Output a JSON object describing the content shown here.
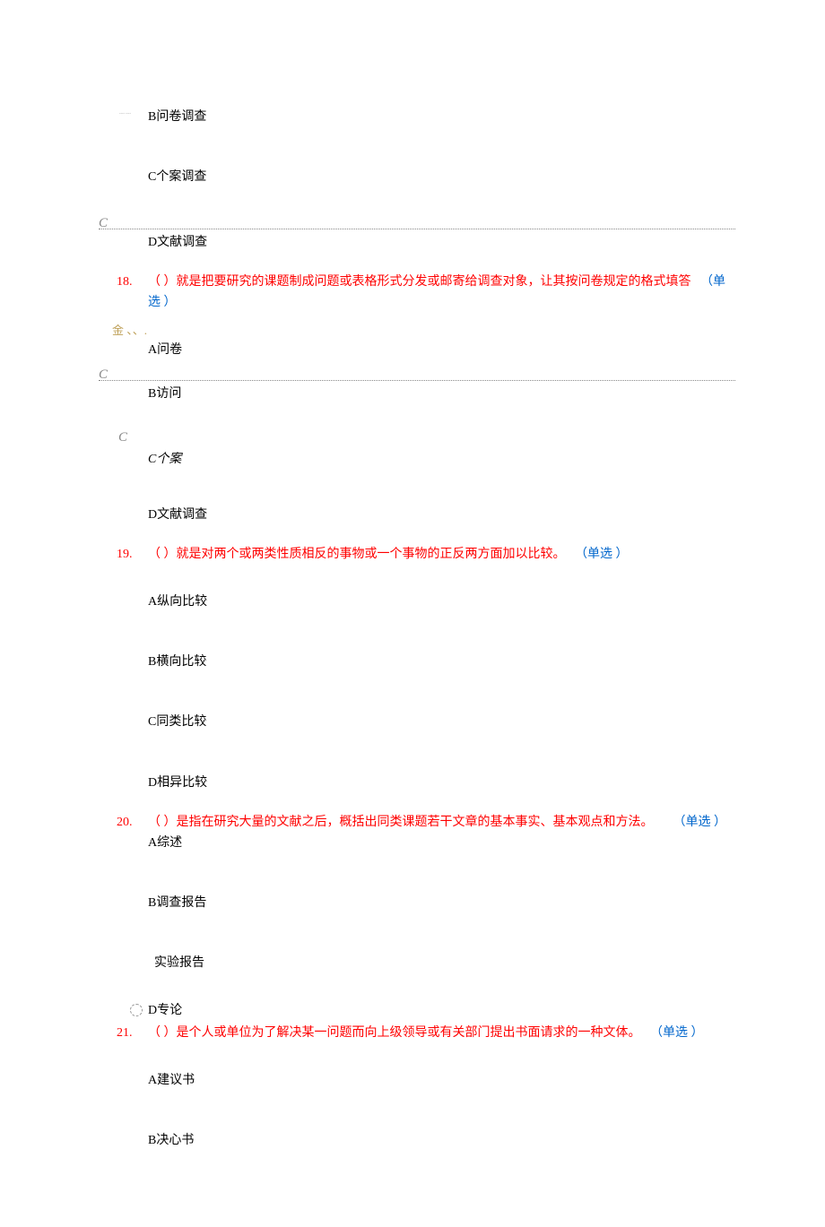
{
  "prev_question": {
    "options": {
      "B": "B问卷调查",
      "C": "C个案调查",
      "D": "D文献调查"
    },
    "margin_C": "C"
  },
  "q18": {
    "num": "18.",
    "stem": "（ ）就是把要研究的课题制成问题或表格形式分发或邮寄给调查对象，让其按问卷规定的格式填答",
    "tag": "（单选 ）",
    "margin_gold": "金 、、.",
    "options": {
      "A": "A问卷",
      "B": "B访问",
      "C": "C个案",
      "D": "D文献调查"
    },
    "margin_C1": "C",
    "margin_C2": "C"
  },
  "q19": {
    "num": "19.",
    "stem": "（ ）就是对两个或两类性质相反的事物或一个事物的正反两方面加以比较。",
    "tag": "（单选 ）",
    "options": {
      "A": "A纵向比较",
      "B": "B横向比较",
      "C": "C同类比较",
      "D": "D相异比较"
    }
  },
  "q20": {
    "num": "20.",
    "stem": "（ ）是指在研究大量的文献之后，概括出同类课题若干文章的基本事实、基本观点和方法。",
    "tag": "（单选 ）",
    "options": {
      "A": "A综述",
      "B": "B调查报告",
      "C": " 实验报告",
      "D": "D专论"
    }
  },
  "q21": {
    "num": "21.",
    "stem": "（ ）是个人或单位为了解决某一问题而向上级领导或有关部门提出书面请求的一种文体。",
    "tag": "（单选 ）",
    "options": {
      "A": "A建议书",
      "B": "B决心书"
    }
  }
}
